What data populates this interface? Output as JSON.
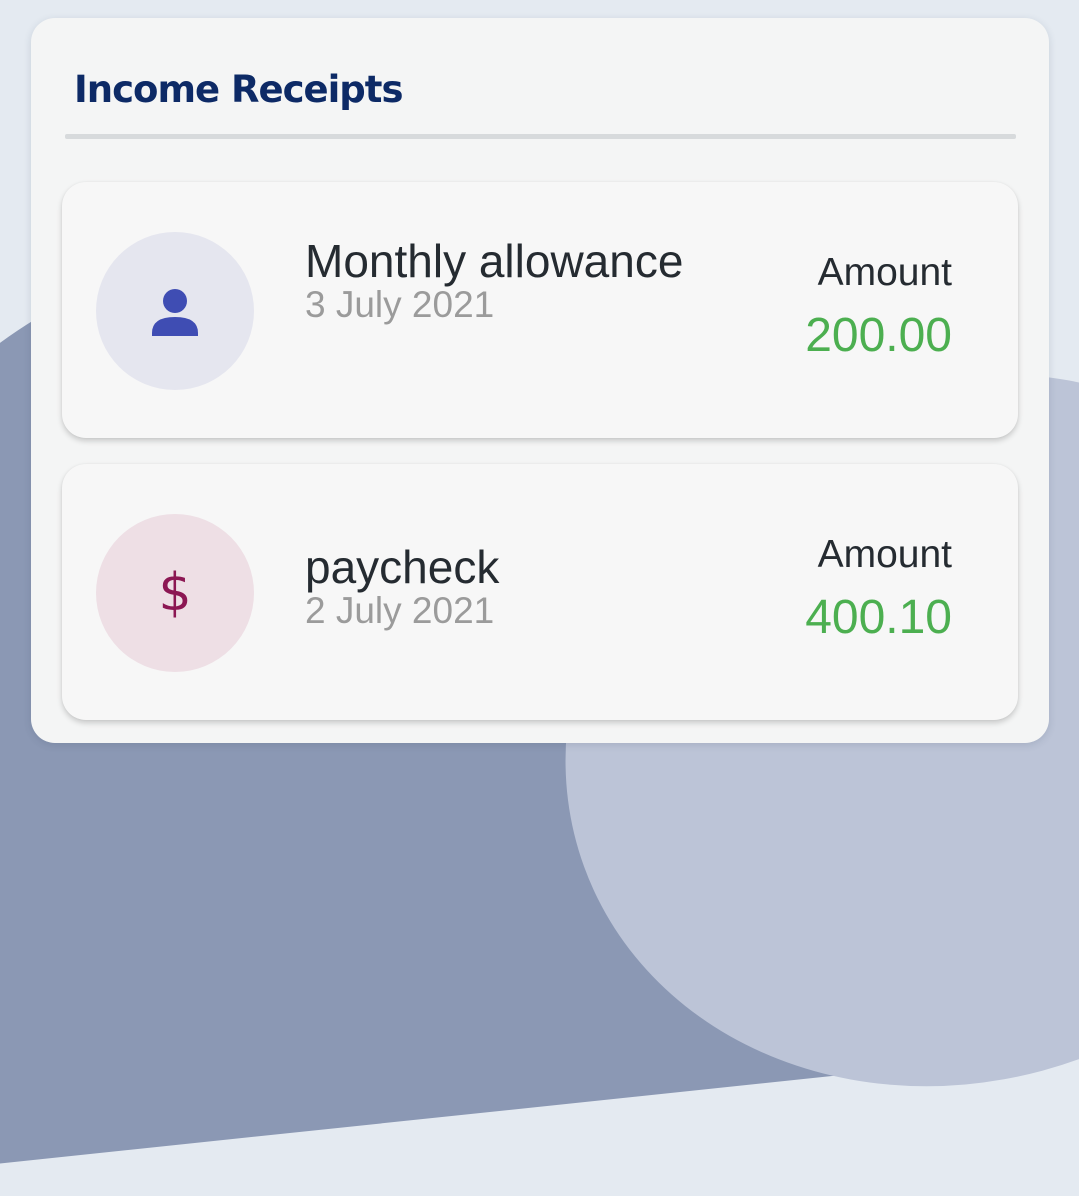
{
  "panel": {
    "title": "Income Receipts"
  },
  "receipts": [
    {
      "name": "Monthly allowance",
      "date": "3 July 2021",
      "amount_label": "Amount",
      "amount": "200.00",
      "icon": "person-icon",
      "icon_color": "#3f4db3",
      "icon_bg": "#e5e6ef"
    },
    {
      "name": "paycheck",
      "date": "2 July 2021",
      "amount_label": "Amount",
      "amount": "400.10",
      "icon": "dollar-icon",
      "icon_glyph": "$",
      "icon_color": "#8c1753",
      "icon_bg": "#eedfe5"
    }
  ],
  "colors": {
    "title": "#0d2a66",
    "amount": "#4caf50",
    "date": "#9b9b9b"
  }
}
